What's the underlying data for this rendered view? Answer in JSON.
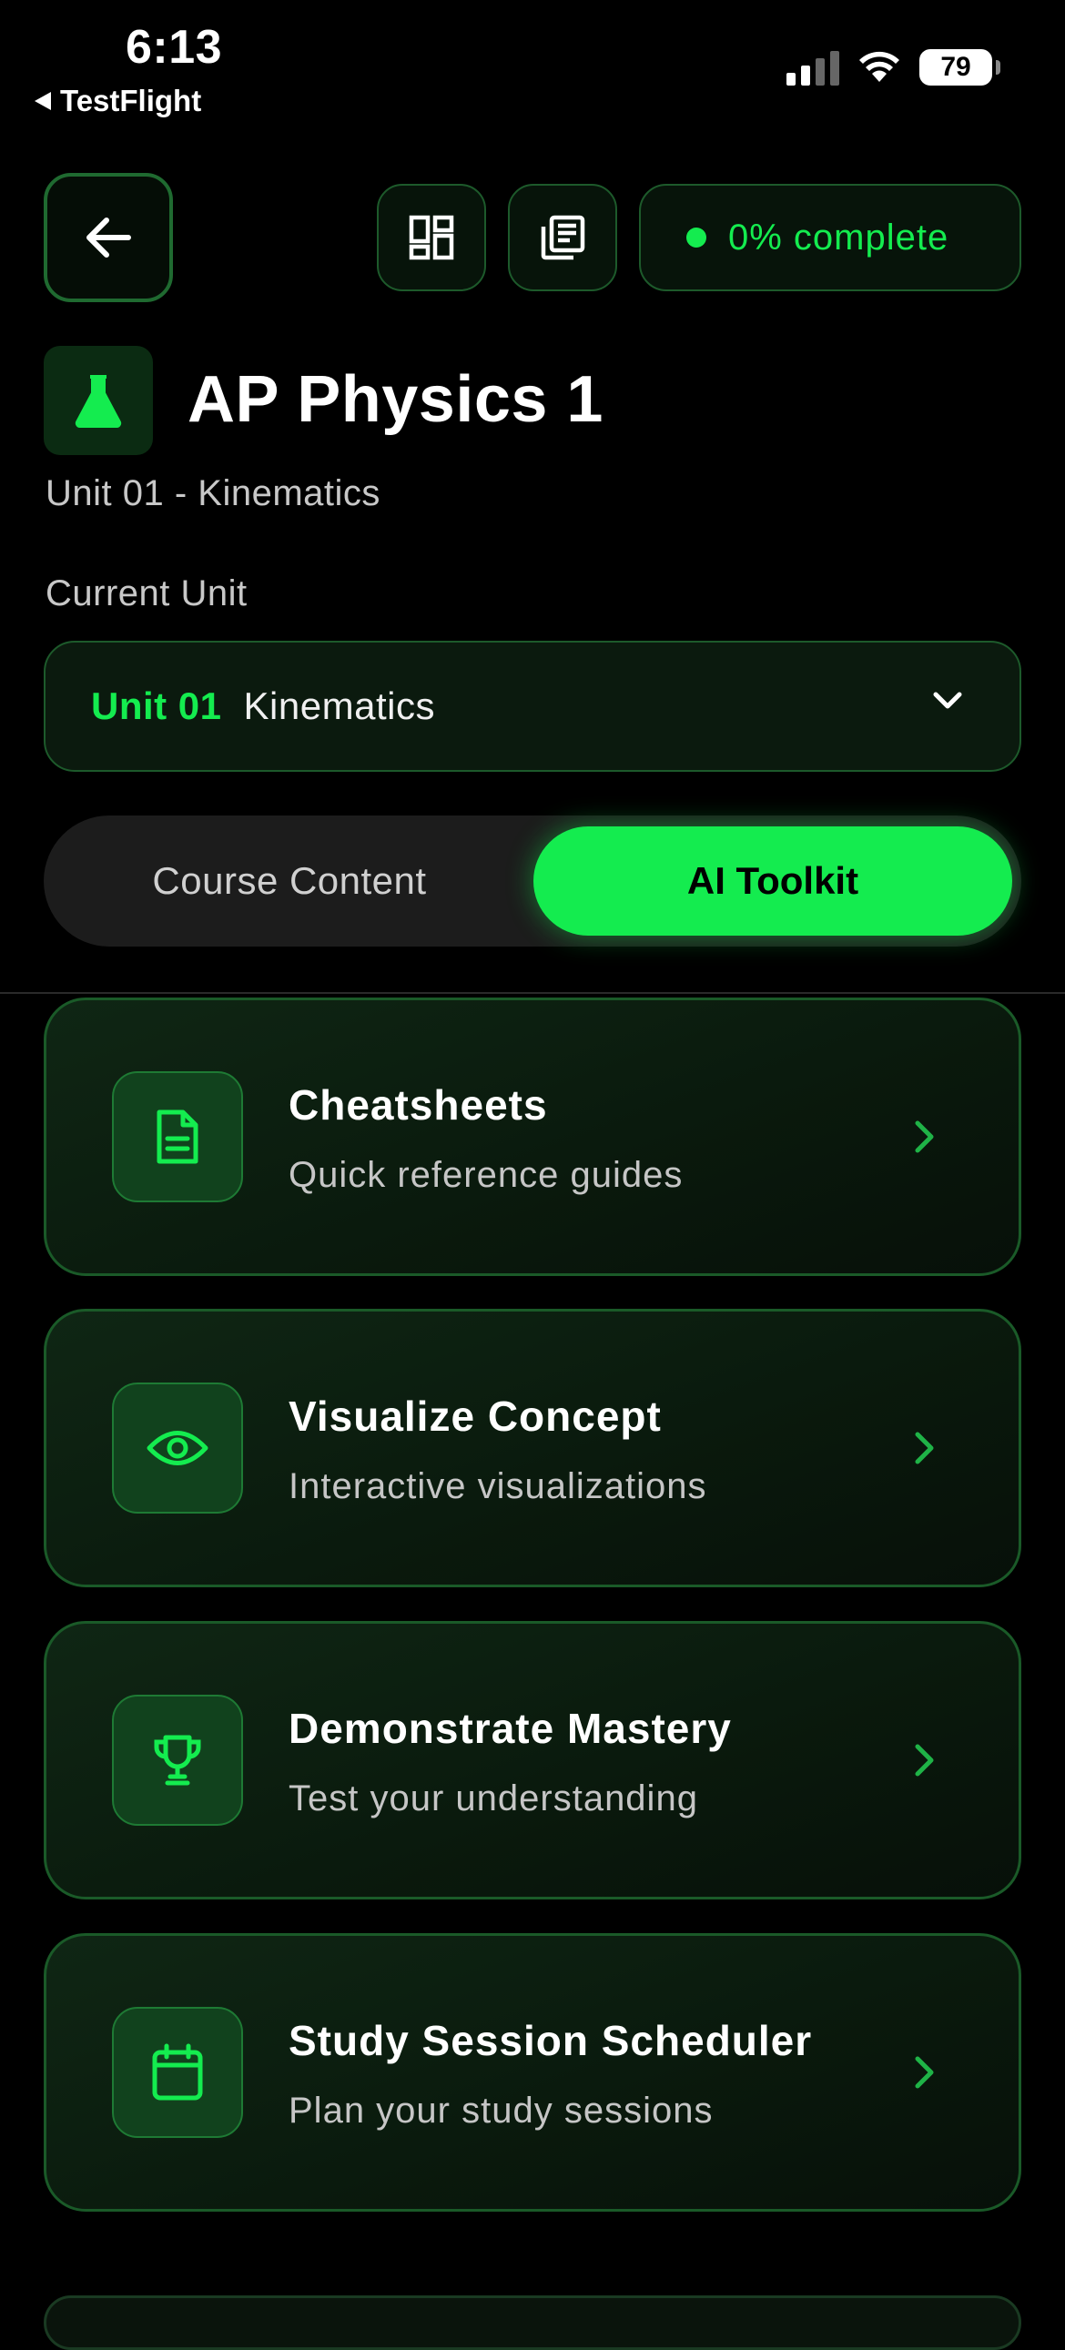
{
  "status_bar": {
    "time": "6:13",
    "back_app": "TestFlight",
    "battery": "79"
  },
  "toolbar": {
    "progress_text": "0% complete"
  },
  "course": {
    "title": "AP Physics 1",
    "subtitle": "Unit 01 - Kinematics"
  },
  "unit_select": {
    "label": "Current Unit",
    "unit_number": "Unit 01",
    "unit_name": "Kinematics"
  },
  "tabs": [
    {
      "label": "Course Content",
      "active": false
    },
    {
      "label": "AI Toolkit",
      "active": true
    }
  ],
  "tools": [
    {
      "title": "Cheatsheets",
      "description": "Quick reference guides",
      "icon": "document-icon"
    },
    {
      "title": "Visualize Concept",
      "description": "Interactive visualizations",
      "icon": "eye-icon"
    },
    {
      "title": "Demonstrate Mastery",
      "description": "Test your understanding",
      "icon": "trophy-icon"
    },
    {
      "title": "Study Session Scheduler",
      "description": "Plan your study sessions",
      "icon": "calendar-icon"
    }
  ],
  "colors": {
    "accent": "#14ec4f",
    "card_border": "#1a5a28",
    "background": "#000000"
  }
}
